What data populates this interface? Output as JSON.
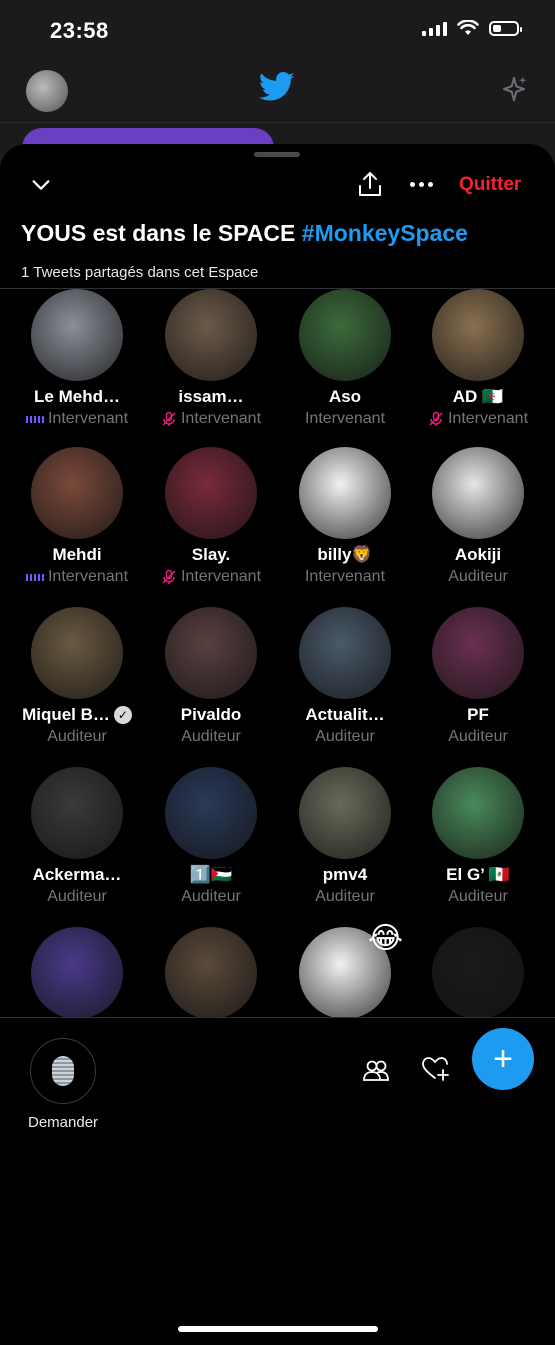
{
  "status_bar": {
    "time": "23:58",
    "battery_level": 0.35
  },
  "background": {
    "logo_icon": "twitter-bird-icon",
    "sparkle_icon": "sparkle-icon"
  },
  "top_bar": {
    "collapse_icon": "chevron-down-icon",
    "share_icon": "share-icon",
    "more_icon": "more-icon",
    "quit_label": "Quitter"
  },
  "space": {
    "title": "YOUS est dans le SPACE",
    "hashtag": "#MonkeySpace",
    "subtitle": "1 Tweets partagés dans cet Espace"
  },
  "participants": [
    {
      "name": "Le Mehd…",
      "role": "Intervenant",
      "status": "speaking",
      "color": "#8a8f98"
    },
    {
      "name": "issam…",
      "role": "Intervenant",
      "status": "muted",
      "color": "#6d5a4a"
    },
    {
      "name": "Aso",
      "role": "Intervenant",
      "status": "none",
      "color": "#3b6b3b"
    },
    {
      "name": "AD 🇩🇿",
      "role": "Intervenant",
      "status": "muted",
      "color": "#8a7050"
    },
    {
      "name": "Mehdi",
      "role": "Intervenant",
      "status": "speaking",
      "color": "#7a4a3a"
    },
    {
      "name": "Slay.",
      "role": "Intervenant",
      "status": "muted",
      "color": "#7a2a3a"
    },
    {
      "name": "billy🦁",
      "role": "Intervenant",
      "status": "none",
      "color": "#f2f2f2"
    },
    {
      "name": "Aokiji",
      "role": "Auditeur",
      "status": "none",
      "color": "#e6e6e6"
    },
    {
      "name": "Miquel B…",
      "role": "Auditeur",
      "status": "verified",
      "color": "#6a5a40"
    },
    {
      "name": "Pivaldo",
      "role": "Auditeur",
      "status": "none",
      "color": "#5a4040"
    },
    {
      "name": "Actualit…",
      "role": "Auditeur",
      "status": "none",
      "color": "#4a5a6a"
    },
    {
      "name": "PF",
      "role": "Auditeur",
      "status": "none",
      "color": "#6a3050"
    },
    {
      "name": "Ackerma…",
      "role": "Auditeur",
      "status": "none",
      "color": "#3a3a3a"
    },
    {
      "name": "1️⃣🇵🇸",
      "role": "Auditeur",
      "status": "none",
      "color": "#2a3a5a"
    },
    {
      "name": "pmv4",
      "role": "Auditeur",
      "status": "none",
      "color": "#6a6a5a"
    },
    {
      "name": "El G’ 🇲🇽",
      "role": "Auditeur",
      "status": "none",
      "color": "#4a8a5a"
    },
    {
      "name": "",
      "role": "",
      "status": "none",
      "color": "#4a3a8a"
    },
    {
      "name": "",
      "role": "",
      "status": "none",
      "color": "#5a4a3a"
    },
    {
      "name": "",
      "role": "",
      "status": "emoji",
      "badge": "😂",
      "color": "#f2f2f2"
    },
    {
      "name": "",
      "role": "",
      "status": "none",
      "color": "#1a1a1a"
    }
  ],
  "bottom_bar": {
    "request_label": "Demander",
    "mic_icon": "microphone-icon",
    "people_icon": "people-icon",
    "reaction_icon": "heart-plus-icon",
    "compose_label": "+"
  }
}
